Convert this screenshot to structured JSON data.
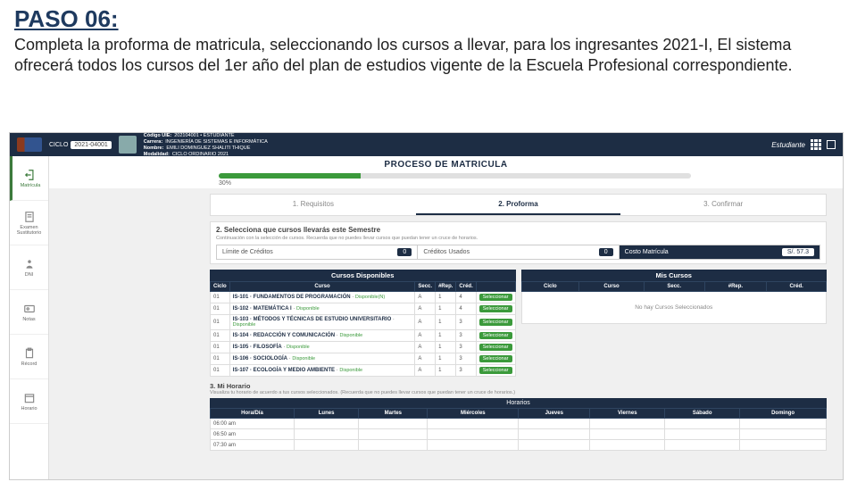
{
  "slide": {
    "title": "PASO 06:",
    "description": "Completa la proforma de matricula, seleccionando los cursos a llevar, para los ingresantes 2021-I, El sistema ofrecerá todos los cursos del 1er año del plan de estudios vigente de la Escuela Profesional correspondiente."
  },
  "topbar": {
    "period_label": "CICLO",
    "period_value": "2021-04001",
    "info": {
      "codigo_lbl": "Código UIE:",
      "codigo_val": "202104001 • ESTUDIANTE",
      "carrera_lbl": "Carrera:",
      "carrera_val": "INGENIERÍA DE SISTEMAS E INFORMÁTICA",
      "nombre_lbl": "Nombre:",
      "nombre_val": "EMILI DOMINGUEZ SHALITI THIQUE",
      "modalidad_lbl": "Modalidad:",
      "modalidad_val": "CICLO ORDINARIO 2021"
    },
    "role": "Estudiante"
  },
  "sidebar": {
    "items": [
      {
        "label": "Matrícula"
      },
      {
        "label": "Examen Sustitutorio"
      },
      {
        "label": "DNI"
      },
      {
        "label": "Notas"
      },
      {
        "label": "Récord"
      },
      {
        "label": "Horario"
      }
    ]
  },
  "page": {
    "title": "PROCESO DE MATRICULA",
    "progress_pct": "30%",
    "steps": [
      "1. Requisitos",
      "2. Proforma",
      "3. Confirmar"
    ],
    "section2_title": "2. Selecciona que cursos llevarás este Semestre",
    "section2_sub": "Continuación con la selección de cursos. Recuerda que no puedes llevar cursos que puedan tener un cruce de horarios.",
    "credits": {
      "limite_lbl": "Límite de Créditos",
      "limite_val": "0",
      "usados_lbl": "Créditos Usados",
      "usados_val": "0",
      "costo_lbl": "Costo Matrícula",
      "costo_val": "S/. 57.3"
    },
    "available": {
      "caption": "Cursos Disponibles",
      "cols": [
        "Ciclo",
        "Curso",
        "Secc.",
        "#Rep.",
        "Créd.",
        ""
      ],
      "rows": [
        {
          "ciclo": "01",
          "code": "IS-101",
          "name": "FUNDAMENTOS DE PROGRAMACIÓN",
          "status": "Disponible(N)",
          "secc": "A",
          "rep": "1",
          "cred": "4",
          "btn": "Seleccionar"
        },
        {
          "ciclo": "01",
          "code": "IS-102",
          "name": "MATEMÁTICA I",
          "status": "Disponible",
          "secc": "A",
          "rep": "1",
          "cred": "4",
          "btn": "Seleccionar"
        },
        {
          "ciclo": "01",
          "code": "IS-103",
          "name": "MÉTODOS Y TÉCNICAS DE ESTUDIO UNIVERSITARIO",
          "status": "Disponible",
          "secc": "A",
          "rep": "1",
          "cred": "3",
          "btn": "Seleccionar"
        },
        {
          "ciclo": "01",
          "code": "IS-104",
          "name": "REDACCIÓN Y COMUNICACIÓN",
          "status": "Disponible",
          "secc": "A",
          "rep": "1",
          "cred": "3",
          "btn": "Seleccionar"
        },
        {
          "ciclo": "01",
          "code": "IS-105",
          "name": "FILOSOFÍA",
          "status": "Disponible",
          "secc": "A",
          "rep": "1",
          "cred": "3",
          "btn": "Seleccionar"
        },
        {
          "ciclo": "01",
          "code": "IS-106",
          "name": "SOCIOLOGÍA",
          "status": "Disponible",
          "secc": "A",
          "rep": "1",
          "cred": "3",
          "btn": "Seleccionar"
        },
        {
          "ciclo": "01",
          "code": "IS-107",
          "name": "ECOLOGÍA Y MEDIO AMBIENTE",
          "status": "Disponible",
          "secc": "A",
          "rep": "1",
          "cred": "3",
          "btn": "Seleccionar"
        }
      ]
    },
    "mycourses": {
      "caption": "Mis Cursos",
      "cols": [
        "Ciclo",
        "Curso",
        "Secc.",
        "#Rep.",
        "Créd."
      ],
      "empty": "No hay Cursos Seleccionados"
    },
    "section3_title": "3. Mi Horario",
    "section3_sub": "Visualiza tu horario de acuerdo a tus cursos seleccionados. (Recuerda que no puedes llevar cursos que puedan tener un cruce de horarios.)",
    "horario": {
      "caption": "Horarios",
      "cols": [
        "Hora/Día",
        "Lunes",
        "Martes",
        "Miércoles",
        "Jueves",
        "Viernes",
        "Sábado",
        "Domingo"
      ],
      "rows": [
        "06:00 am",
        "06:50 am",
        "07:30 am"
      ]
    }
  }
}
